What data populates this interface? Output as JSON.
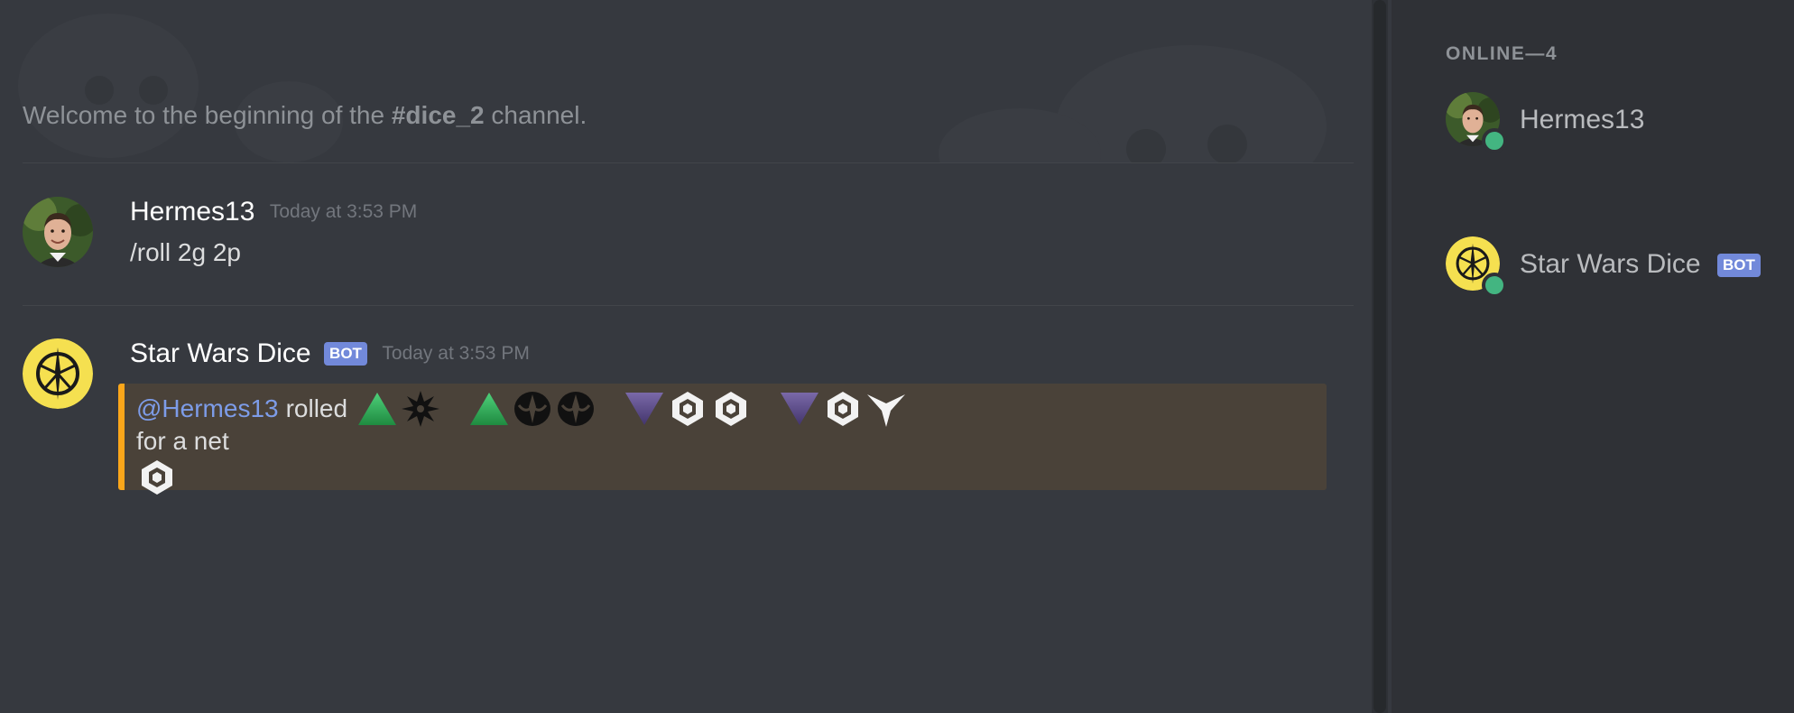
{
  "chat": {
    "welcome_prefix": "Welcome to the beginning of the ",
    "channel_name": "#dice_2",
    "welcome_suffix": " channel."
  },
  "messages": [
    {
      "author": "Hermes13",
      "timestamp": "Today at 3:53 PM",
      "text": "/roll 2g 2p",
      "avatar_icon": "user-photo-avatar"
    },
    {
      "author": "Star Wars Dice",
      "bot_tag": "BOT",
      "timestamp": "Today at 3:53 PM",
      "avatar_icon": "jedi-order-emblem",
      "embed": {
        "mention": "@Hermes13",
        "rolled_word": "rolled",
        "dice_groups": [
          [
            "ability-die-icon",
            "advantage-symbol-icon"
          ],
          [
            "ability-die-icon",
            "success-symbol-icon",
            "success-symbol-icon"
          ],
          [
            "difficulty-die-icon",
            "failure-symbol-icon",
            "failure-symbol-icon"
          ],
          [
            "difficulty-die-icon",
            "failure-symbol-icon",
            "threat-symbol-icon"
          ]
        ],
        "net_text": "for a net",
        "net_result_icon": "failure-symbol-icon",
        "accent_color": "#faa61a",
        "background_color": "#4a4239"
      }
    }
  ],
  "members": {
    "header": "ONLINE—4",
    "list": [
      {
        "name": "Hermes13",
        "status": "online"
      },
      {
        "name": "Star Wars Dice",
        "bot_tag": "BOT",
        "status": "online"
      }
    ]
  },
  "colors": {
    "background": "#36393f",
    "sidebar": "#2f3136",
    "mention": "#7d9ce8",
    "bot_tag": "#7289da",
    "online": "#43b581"
  }
}
